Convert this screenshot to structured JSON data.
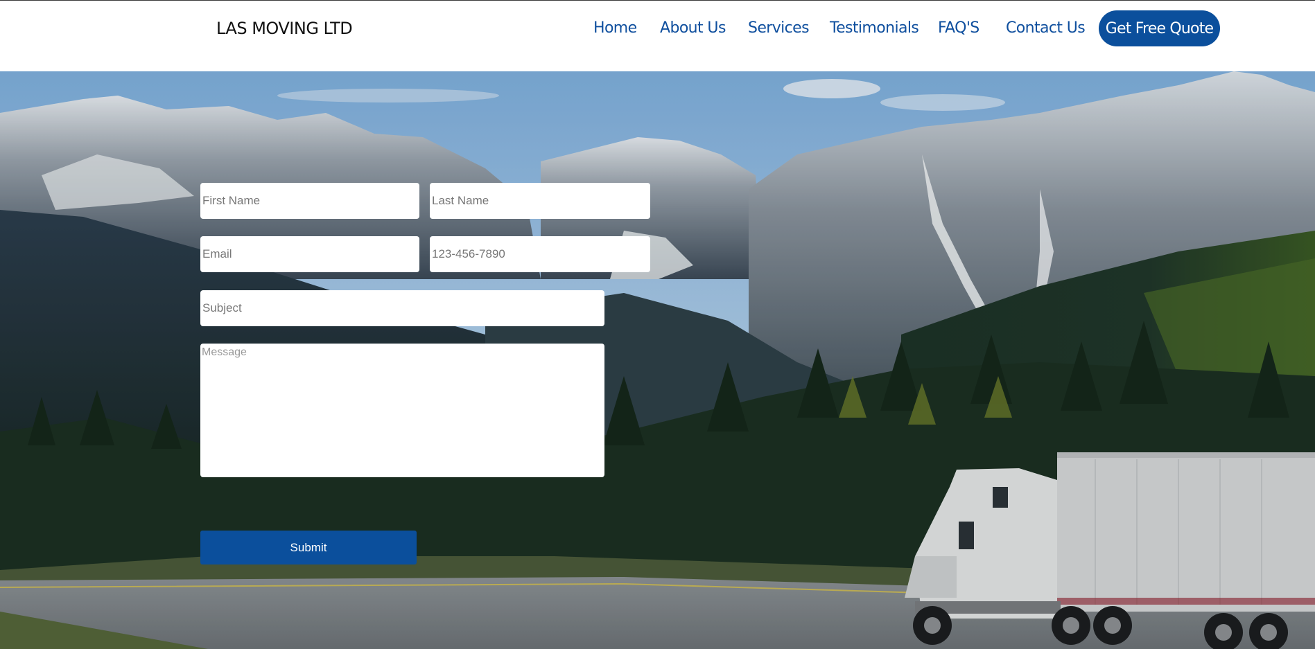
{
  "brand": {
    "name": "LAS MOVING LTD"
  },
  "nav": {
    "items": [
      "Home",
      "About Us",
      "Services",
      "Testimonials",
      "FAQ'S",
      "Contact Us"
    ],
    "cta_label": "Get Free Quote"
  },
  "form": {
    "first_name_placeholder": "First Name",
    "last_name_placeholder": "Last Name",
    "email_placeholder": "Email",
    "phone_placeholder": "123-456-7890",
    "subject_placeholder": "Subject",
    "message_placeholder": "Message",
    "submit_label": "Submit"
  },
  "colors": {
    "brand_blue": "#0b4f9c",
    "nav_text": "#0f4f9e"
  }
}
